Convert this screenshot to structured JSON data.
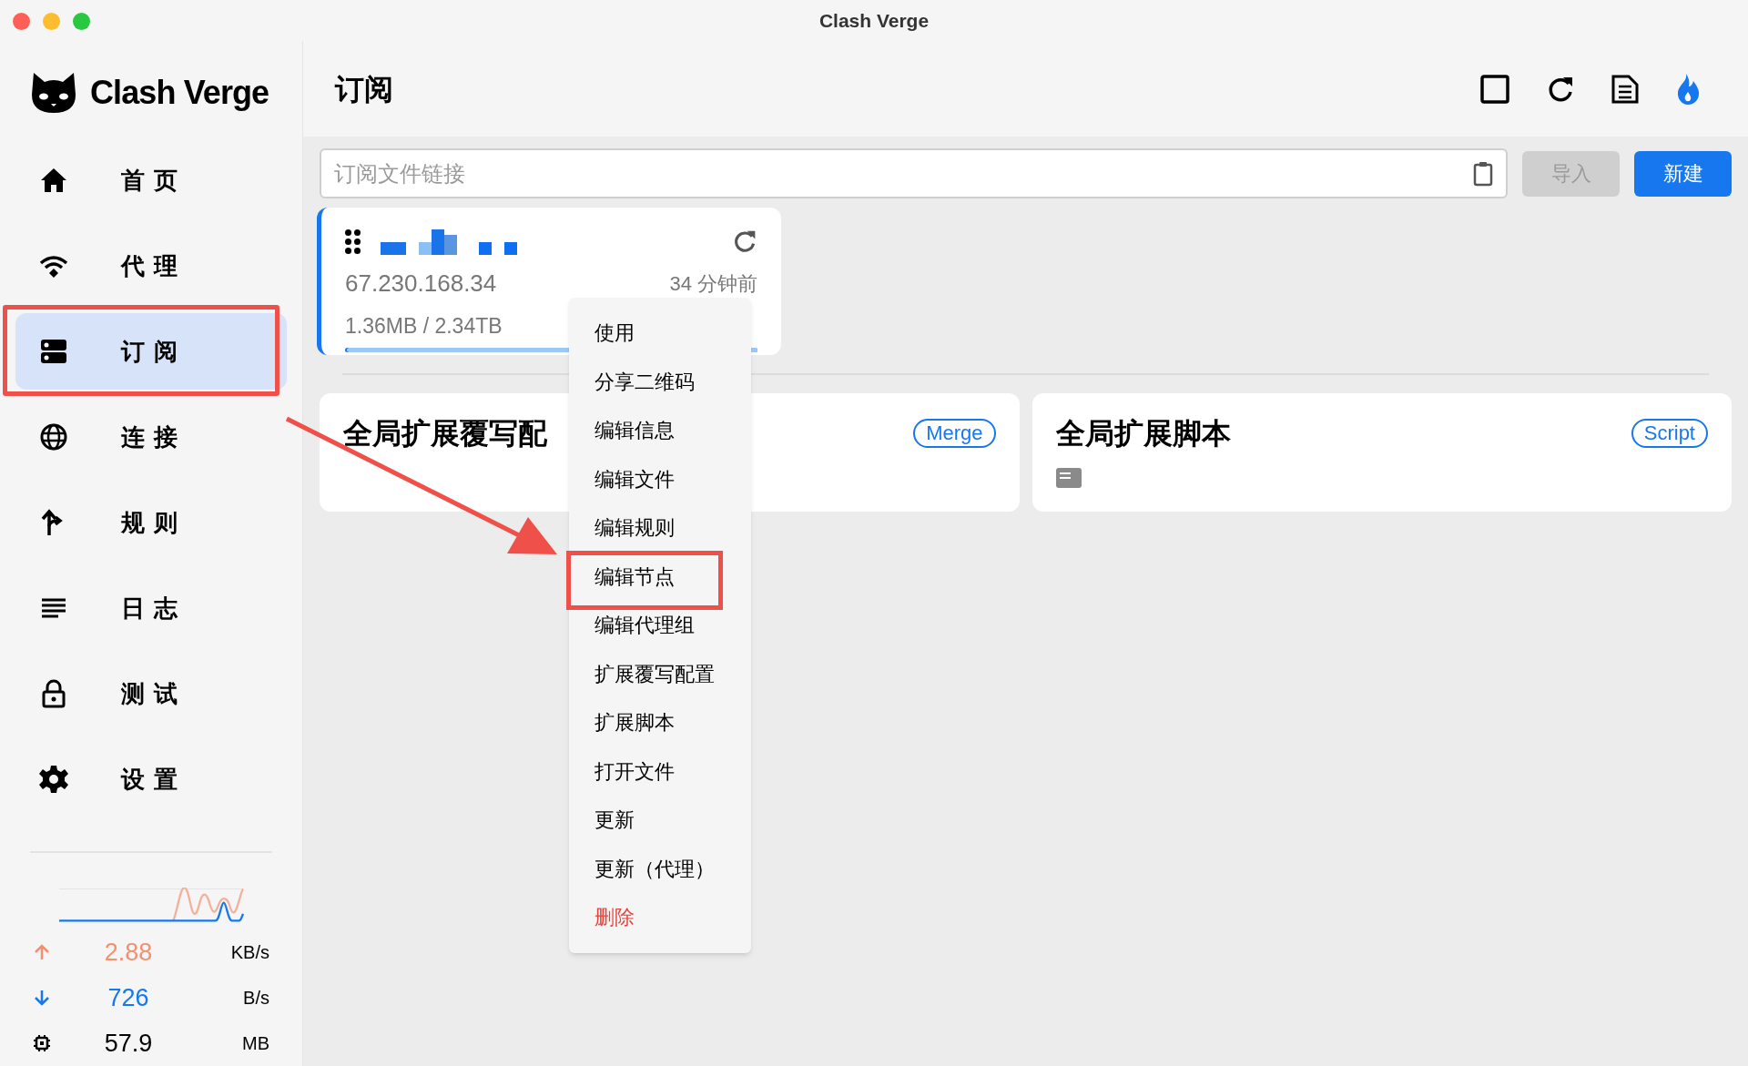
{
  "window": {
    "title": "Clash Verge"
  },
  "sidebar": {
    "app_name": "Clash Verge",
    "items": [
      {
        "label": "首页",
        "selected": false,
        "annotated": false
      },
      {
        "label": "代理",
        "selected": false,
        "annotated": false
      },
      {
        "label": "订阅",
        "selected": true,
        "annotated": true
      },
      {
        "label": "连接",
        "selected": false,
        "annotated": false
      },
      {
        "label": "规则",
        "selected": false,
        "annotated": false
      },
      {
        "label": "日志",
        "selected": false,
        "annotated": false
      },
      {
        "label": "测试",
        "selected": false,
        "annotated": false
      },
      {
        "label": "设置",
        "selected": false,
        "annotated": false
      }
    ],
    "traffic": [
      {
        "kind": "up",
        "value": "2.88",
        "unit": "KB/s"
      },
      {
        "kind": "down",
        "value": "726",
        "unit": "B/s"
      },
      {
        "kind": "memory",
        "value": "57.9",
        "unit": "MB"
      }
    ]
  },
  "header": {
    "title": "订阅"
  },
  "import_bar": {
    "placeholder": "订阅文件链接",
    "import_button": {
      "label": "导入",
      "disabled": true
    },
    "new_button": {
      "label": "新建"
    }
  },
  "profile_card": {
    "selected": true,
    "host": "67.230.168.34",
    "updated": "34 分钟前",
    "usage": "1.36MB / 2.34TB",
    "level": 0.995
  },
  "global_cards": [
    {
      "title": "全局扩展覆写配",
      "tag": "Merge",
      "has_file_icon": false
    },
    {
      "title": "全局扩展脚本",
      "tag": "Script",
      "has_file_icon": true
    }
  ],
  "context_menu": [
    {
      "label": "使用",
      "danger": false,
      "annotated": false
    },
    {
      "label": "分享二维码",
      "danger": false,
      "annotated": false
    },
    {
      "label": "编辑信息",
      "danger": false,
      "annotated": false
    },
    {
      "label": "编辑文件",
      "danger": false,
      "annotated": false
    },
    {
      "label": "编辑规则",
      "danger": false,
      "annotated": false
    },
    {
      "label": "编辑节点",
      "danger": false,
      "annotated": true
    },
    {
      "label": "编辑代理组",
      "danger": false,
      "annotated": false
    },
    {
      "label": "扩展覆写配置",
      "danger": false,
      "annotated": false
    },
    {
      "label": "扩展脚本",
      "danger": false,
      "annotated": false
    },
    {
      "label": "打开文件",
      "danger": false,
      "annotated": false
    },
    {
      "label": "更新",
      "danger": false,
      "annotated": false
    },
    {
      "label": "更新（代理）",
      "danger": false,
      "annotated": false
    },
    {
      "label": "删除",
      "danger": true,
      "annotated": false
    }
  ]
}
